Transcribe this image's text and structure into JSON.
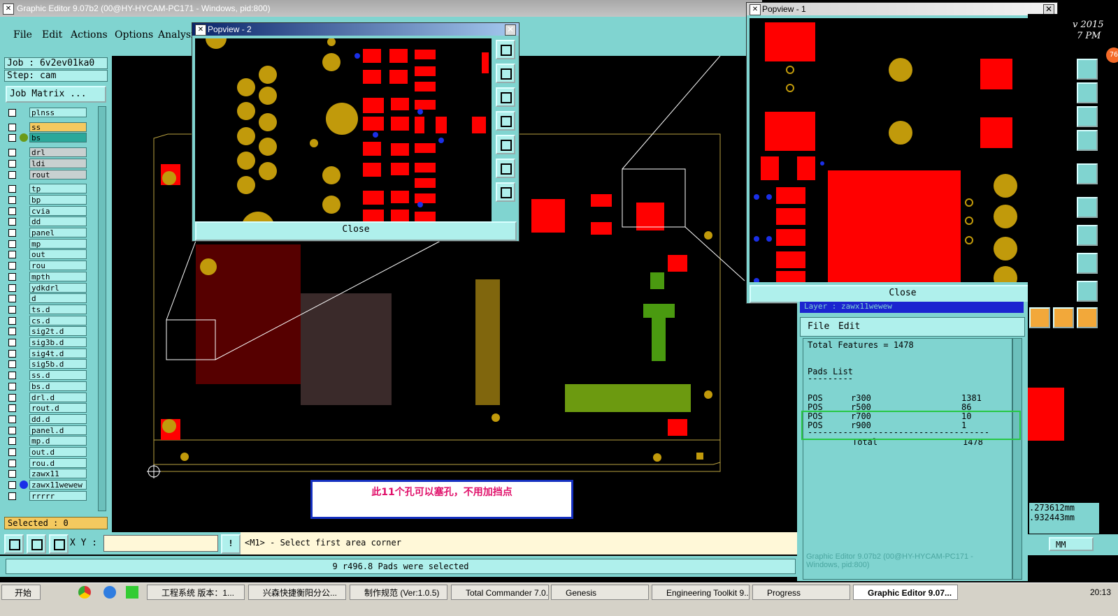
{
  "main_window": {
    "title": "Graphic Editor 9.07b2 (00@HY-HYCAM-PC171 - Windows, pid:800)"
  },
  "menu": {
    "file": "File",
    "edit": "Edit",
    "actions": "Actions",
    "options": "Options",
    "analysis": "Analysi"
  },
  "left_panel": {
    "job": "Job : 6v2ev01ka0",
    "step": "Step: cam",
    "job_matrix": "Job Matrix ...",
    "selected": "Selected : 0",
    "layers": [
      "plnss",
      "ss",
      "bs",
      "drl",
      "ldi",
      "rout",
      "tp",
      "bp",
      "cvia",
      "dd",
      "panel",
      "mp",
      "out",
      "rou",
      "mpth",
      "ydkdrl",
      "d",
      "ts.d",
      "cs.d",
      "sig2t.d",
      "sig3b.d",
      "sig4t.d",
      "sig5b.d",
      "ss.d",
      "bs.d",
      "drl.d",
      "rout.d",
      "dd.d",
      "panel.d",
      "mp.d",
      "out.d",
      "rou.d",
      "zawx11",
      "zawx11wewew",
      "rrrrr"
    ]
  },
  "colors": {
    "teal": "#80d4d0",
    "ss_layer": "#f4c95f",
    "bs_layer": "#2ba89a",
    "pad_red": "#ff0000",
    "pad_gold": "#c19a0b",
    "via_blue": "#1a2fe8",
    "note_text": "#e0106a"
  },
  "popview2": {
    "title": "Popview - 2",
    "close": "Close"
  },
  "popview1": {
    "title": "Popview - 1",
    "close": "Close"
  },
  "bottom": {
    "xy_label": "X Y :",
    "prompt": "<M1> - Select first area corner",
    "status": "9 r496.8 Pads were selected"
  },
  "note": {
    "text": "此11个孔可以塞孔，不用加挡点"
  },
  "report": {
    "layer_label": "Layer : zawx11wewew",
    "menu_file": "File",
    "menu_edit": "Edit",
    "total_features": "Total Features = 1478",
    "pads_list": "Pads List",
    "underline": "---------",
    "rows": [
      {
        "type": "POS",
        "sym": "r300",
        "count": "1381"
      },
      {
        "type": "POS",
        "sym": "r500",
        "count": "86"
      },
      {
        "type": "POS",
        "sym": "r700",
        "count": "10"
      },
      {
        "type": "POS",
        "sym": "r900",
        "count": "1"
      }
    ],
    "separator": "------------------------------------",
    "total_label": "Total",
    "total_value": "1478",
    "ghost_title": "Graphic Editor 9.07b2 (00@HY-HYCAM-PC171 - Windows, pid:800)"
  },
  "right_strip": {
    "date_fragment": "v 2015",
    "time_fragment": "7 PM",
    "coord1": ".273612mm",
    "coord2": ".932443mm",
    "units": "MM",
    "badge": "76"
  },
  "taskbar": {
    "start": "开始",
    "tasks": [
      "工程系统  版本：1...",
      "兴森快捷衡阳分公...",
      "制作规范 (Ver:1.0.5)",
      "Total Commander 7.0...",
      "Genesis",
      "Engineering Toolkit 9....",
      "Progress",
      "Graphic Editor 9.07..."
    ],
    "clock": "20:13"
  }
}
